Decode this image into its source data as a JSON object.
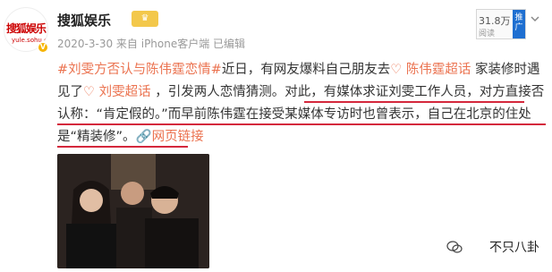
{
  "account": {
    "name": "搜狐娱乐",
    "avatar_text": "搜狐娱乐",
    "avatar_url_text": "yule.sohu.com",
    "verified_badge": "V",
    "vip_label": "♛",
    "meta": "2020-3-30 来自 iPhone客户端 已编辑"
  },
  "follow": {
    "count": "31.8万",
    "sub": "阅读",
    "tag": "推广"
  },
  "post": {
    "topic1": "#刘雯方否认与陈伟霆恋情#",
    "t1": "近日，有网友爆料自己朋友去",
    "link1_icon": "♡",
    "link1": "陈伟霆超话",
    "t2": " 家装修时遇见了",
    "link2_icon": "♡",
    "link2": "刘雯超话",
    "t3": " ，引发两人恋情猜测。",
    "h1": "对此，有媒体求证刘雯工作人员，对方直接否认称：“肯定假的。”",
    "h2": "而早前陈伟霆在接受某媒体专访时也曾表示，自己在北京的住处是“精装修”。",
    "weblink_icon": "🔗",
    "weblink": "网页链接"
  },
  "watermark": "不只八卦",
  "colors": {
    "accent": "#eb7350",
    "underline": "#d4283c",
    "tag_blue": "#1e6fd1",
    "vip_gold": "#f3c84b"
  }
}
